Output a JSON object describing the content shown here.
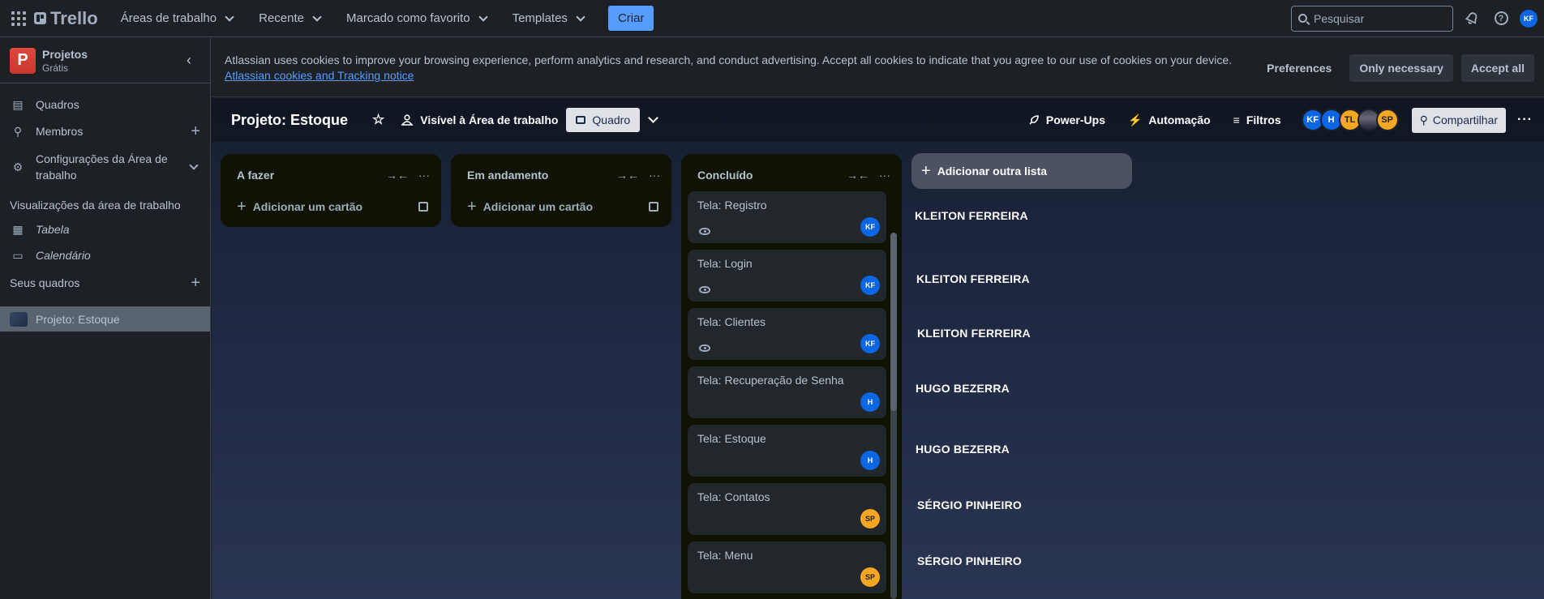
{
  "topbar": {
    "logo": "Trello",
    "nav": [
      "Áreas de trabalho",
      "Recente",
      "Marcado como favorito",
      "Templates"
    ],
    "create_label": "Criar",
    "search_placeholder": "Pesquisar",
    "user_initials": "KF"
  },
  "sidebar": {
    "workspace_initial": "P",
    "workspace_name": "Projetos",
    "workspace_plan": "Grátis",
    "items": [
      {
        "label": "Quadros",
        "icon": "board-icon"
      },
      {
        "label": "Membros",
        "icon": "person-icon"
      },
      {
        "label": "Configurações da Área de trabalho",
        "icon": "gear-icon"
      }
    ],
    "views_heading": "Visualizações da área de trabalho",
    "views": [
      "Tabela",
      "Calendário"
    ],
    "boards_heading": "Seus quadros",
    "boards": [
      "Projeto: Estoque"
    ]
  },
  "cookie": {
    "text": "Atlassian uses cookies to improve your browsing experience, perform analytics and research, and conduct advertising. Accept all cookies to indicate that you agree to our use of cookies on your device.",
    "link": "Atlassian cookies and Tracking notice",
    "preferences": "Preferences",
    "only_necessary": "Only necessary",
    "accept_all": "Accept all"
  },
  "board": {
    "title": "Projeto: Estoque",
    "visibility": "Visível à Área de trabalho",
    "view": "Quadro",
    "powerups": "Power-Ups",
    "automation": "Automação",
    "filters": "Filtros",
    "members": [
      "KF",
      "H",
      "TL",
      "",
      "SP"
    ],
    "share": "Compartilhar"
  },
  "lists": [
    {
      "title": "A fazer",
      "add_card": "Adicionar um cartão"
    },
    {
      "title": "Em andamento",
      "add_card": "Adicionar um cartão"
    },
    {
      "title": "Concluído",
      "cards": [
        {
          "title": "Tela: Registro",
          "member": "KF"
        },
        {
          "title": "Tela: Login",
          "member": "KF"
        },
        {
          "title": "Tela: Clientes",
          "member": "KF"
        },
        {
          "title": "Tela: Recuperação de Senha",
          "member": "H"
        },
        {
          "title": "Tela: Estoque",
          "member": "H"
        },
        {
          "title": "Tela: Contatos",
          "member": "SP"
        },
        {
          "title": "Tela: Menu",
          "member": "SP"
        }
      ]
    }
  ],
  "add_list": "Adicionar outra lista",
  "notes": [
    "KLEITON FERREIRA",
    "KLEITON FERREIRA",
    "KLEITON FERREIRA",
    "HUGO BEZERRA",
    "HUGO BEZERRA",
    "SÉRGIO PINHEIRO",
    "SÉRGIO PINHEIRO"
  ],
  "colors": {
    "accent": "#579dff",
    "member_blue": "#0c66e4",
    "member_orange": "#f5a623"
  }
}
